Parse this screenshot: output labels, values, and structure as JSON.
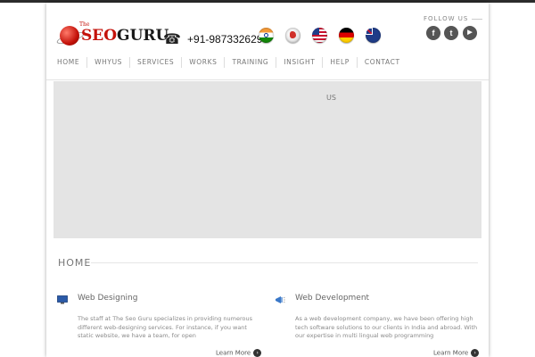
{
  "header": {
    "logo": {
      "small": "The",
      "brand_part1": "SEO",
      "brand_part2": "GURU"
    },
    "phone": "+91-9873326290",
    "flags": [
      "india-flag",
      "world-flag",
      "usa-flag",
      "germany-flag",
      "australia-flag"
    ],
    "follow_label": "FOLLOW US",
    "social": [
      "facebook-icon",
      "twitter-icon",
      "youtube-icon"
    ]
  },
  "nav": {
    "items": [
      "HOME",
      "WHYUS",
      "SERVICES",
      "WORKS",
      "TRAINING",
      "INSIGHT",
      "HELP",
      "CONTACT"
    ]
  },
  "banner": {
    "text": "US"
  },
  "home": {
    "title": "HOME"
  },
  "services": [
    {
      "title": "Web Designing",
      "icon": "monitor-icon",
      "description": "The staff at The Seo Guru specializes in providing numerous different web-designing services. For instance, if you want static website, we have a team, for open",
      "link": "Learn More"
    },
    {
      "title": "Web Development",
      "icon": "megaphone-icon",
      "description": "As a web development company, we have been offering high tech software solutions to our clients in India and abroad. With our expertise in multi lingual web programming",
      "link": "Learn More"
    }
  ],
  "colors": {
    "brand_red": "#c4120a",
    "banner_gray": "#e4e4e4",
    "top_bar": "#2b2b2b"
  }
}
